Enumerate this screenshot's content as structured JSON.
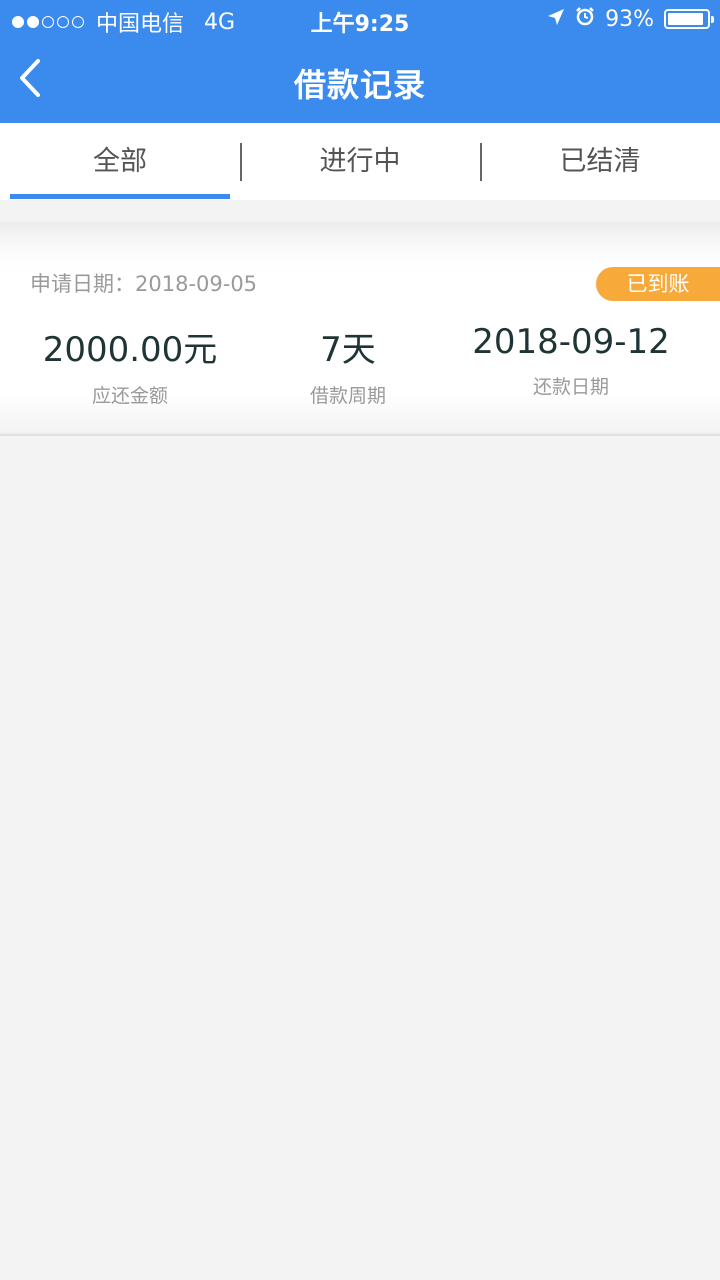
{
  "status_bar": {
    "carrier": "中国电信",
    "network": "4G",
    "time": "上午9:25",
    "battery": "93%",
    "battery_level": 0.93
  },
  "header": {
    "title": "借款记录"
  },
  "tabs": [
    {
      "label": "全部",
      "active": true
    },
    {
      "label": "进行中",
      "active": false
    },
    {
      "label": "已结清",
      "active": false
    }
  ],
  "record": {
    "apply_date": "申请日期：2018-09-05",
    "status": "已到账",
    "amount": "2000.00元",
    "amount_label": "应还金额",
    "period": "7天",
    "period_label": "借款周期",
    "due_date": "2018-09-12",
    "due_date_label": "还款日期"
  },
  "colors": {
    "primary": "#3b8aee",
    "badge": "#f7a93a",
    "background": "#f3f3f3"
  }
}
